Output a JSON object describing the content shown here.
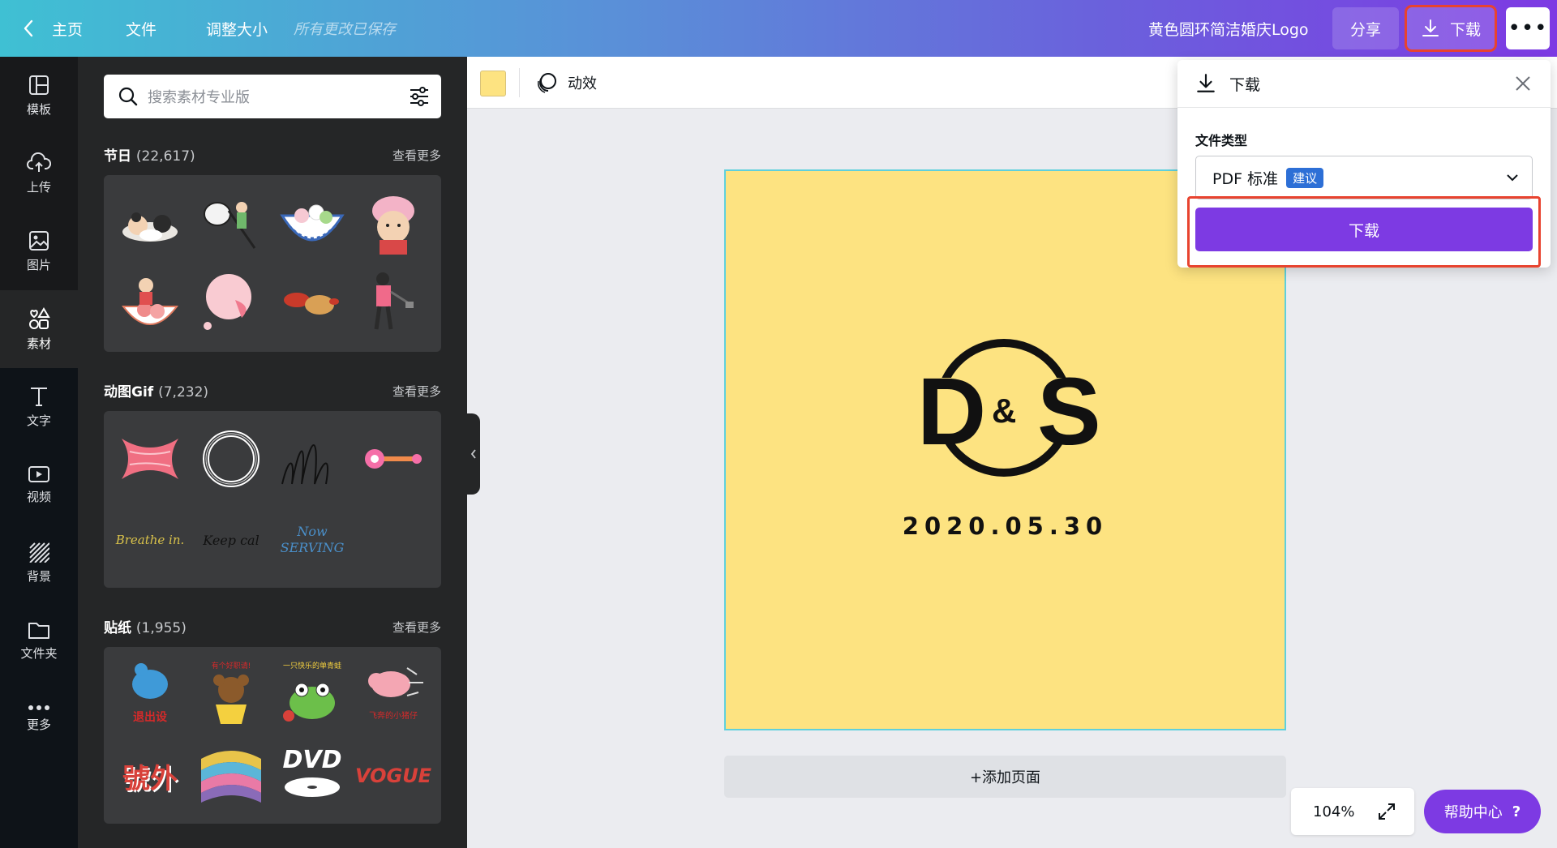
{
  "topbar": {
    "home": "主页",
    "file": "文件",
    "resize": "调整大小",
    "saved_status": "所有更改已保存",
    "design_title": "黄色圆环简洁婚庆Logo",
    "share": "分享",
    "download": "下载",
    "more": "•••"
  },
  "nav": [
    {
      "label": "模板",
      "icon": "template-icon"
    },
    {
      "label": "上传",
      "icon": "upload-icon"
    },
    {
      "label": "图片",
      "icon": "image-icon"
    },
    {
      "label": "素材",
      "icon": "elements-icon"
    },
    {
      "label": "文字",
      "icon": "text-icon"
    },
    {
      "label": "视频",
      "icon": "video-icon"
    },
    {
      "label": "背景",
      "icon": "background-icon"
    },
    {
      "label": "文件夹",
      "icon": "folder-icon"
    },
    {
      "label": "更多",
      "icon": "more-icon"
    }
  ],
  "panel": {
    "search_placeholder": "搜索素材专业版",
    "sections": [
      {
        "title": "节日",
        "count": "(22,617)",
        "more": "查看更多"
      },
      {
        "title": "动图Gif",
        "count": "(7,232)",
        "more": "查看更多"
      },
      {
        "title": "贴纸",
        "count": "(1,955)",
        "more": "查看更多"
      }
    ],
    "gif_texts": [
      "Breathe in.",
      "Keep cal",
      "Now SERVING"
    ],
    "sticker_texts": [
      "退出设",
      "有个好职请!",
      "一只快乐的单青蛙",
      "飞奔的小猪仔",
      "號外",
      "DVD",
      "VOGUE"
    ]
  },
  "canvas_toolbar": {
    "animate": "动效",
    "swatch_color": "#fde381"
  },
  "page": {
    "logo_left": "D",
    "logo_amp": "&",
    "logo_right": "S",
    "date": "2020.05.30",
    "background": "#fde381"
  },
  "add_page": "+添加页面",
  "zoom": "104%",
  "help": {
    "label": "帮助中心",
    "q": "?"
  },
  "download_panel": {
    "title": "下载",
    "file_type_label": "文件类型",
    "file_type_value": "PDF 标准",
    "badge": "建议",
    "button": "下载"
  },
  "colors": {
    "accent": "#7d3ae3",
    "highlight": "#e8432f"
  }
}
